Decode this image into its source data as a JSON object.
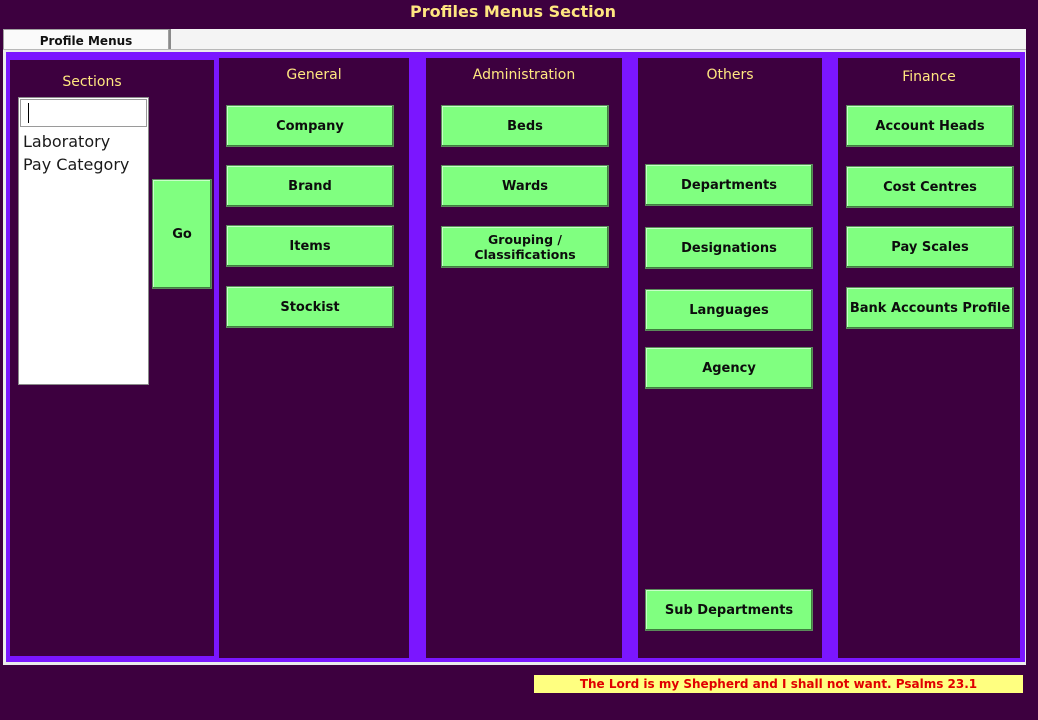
{
  "window_title": "Profiles Menus Section",
  "tab": {
    "label": "Profile Menus"
  },
  "sections": {
    "label": "Sections",
    "search_value": "",
    "items": [
      "Laboratory",
      "Pay Category"
    ],
    "go_label": "Go"
  },
  "general": {
    "label": "General",
    "buttons": [
      "Company",
      "Brand",
      "Items",
      "Stockist"
    ]
  },
  "administration": {
    "label": "Administration",
    "buttons": [
      "Beds",
      "Wards",
      "Grouping / Classifications"
    ]
  },
  "others": {
    "label": "Others",
    "buttons": [
      "Departments",
      "Designations",
      "Languages",
      "Agency",
      "Sub Departments"
    ]
  },
  "finance": {
    "label": "Finance",
    "buttons": [
      "Account Heads",
      "Cost Centres",
      "Pay Scales",
      "Bank Accounts Profile"
    ]
  },
  "footer": {
    "text": "The Lord is my Shepherd and I shall not want.  Psalms 23.1"
  },
  "colors": {
    "background": "#3d003f",
    "panel": "#7b16ff",
    "button": "#80ff80",
    "heading": "#ffe680",
    "footer_bg": "#ffff80",
    "footer_text": "#e00000"
  }
}
